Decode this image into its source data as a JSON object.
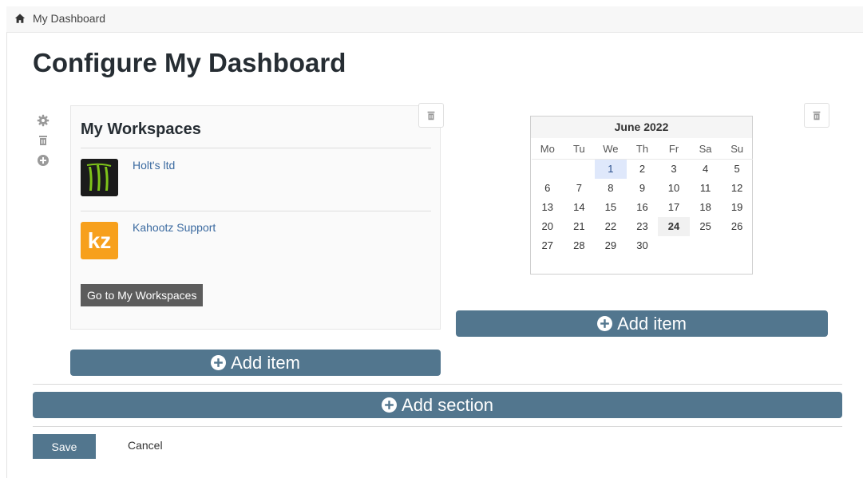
{
  "breadcrumb": {
    "label": "My Dashboard"
  },
  "page": {
    "title": "Configure My Dashboard"
  },
  "workspaces_widget": {
    "title": "My Workspaces",
    "items": [
      {
        "name": "Holt's ltd",
        "logo": "monster-logo-icon"
      },
      {
        "name": "Kahootz Support",
        "logo_text": "kz"
      }
    ],
    "go_button": "Go to My Workspaces"
  },
  "calendar": {
    "month_label": "June 2022",
    "weekdays": [
      "Mo",
      "Tu",
      "We",
      "Th",
      "Fr",
      "Sa",
      "Su"
    ],
    "weeks": [
      [
        "",
        "",
        "1",
        "2",
        "3",
        "4",
        "5"
      ],
      [
        "6",
        "7",
        "8",
        "9",
        "10",
        "11",
        "12"
      ],
      [
        "13",
        "14",
        "15",
        "16",
        "17",
        "18",
        "19"
      ],
      [
        "20",
        "21",
        "22",
        "23",
        "24",
        "25",
        "26"
      ],
      [
        "27",
        "28",
        "29",
        "30",
        "",
        "",
        ""
      ]
    ],
    "selected_day": "1",
    "today_day": "24"
  },
  "buttons": {
    "add_item": "Add item",
    "add_section": "Add section",
    "save": "Save",
    "cancel": "Cancel"
  },
  "colors": {
    "accent": "#52768e",
    "link": "#3b6aa0",
    "kz_orange": "#f7a01c"
  }
}
